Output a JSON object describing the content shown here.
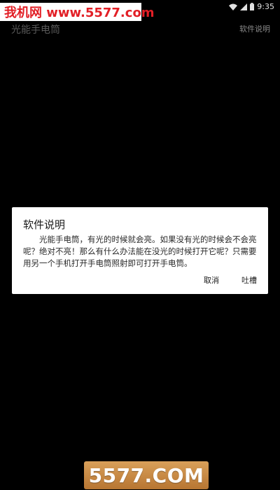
{
  "status_bar": {
    "time": "9:35",
    "icons": [
      "wifi-icon",
      "signal-icon",
      "battery-icon"
    ]
  },
  "watermark_top": {
    "text": "我机网 www.5577.com",
    "color": "#e21f26"
  },
  "app_bar": {
    "title": "光能手电筒",
    "action_label": "软件说明"
  },
  "dialog": {
    "title": "软件说明",
    "message": "光能手电筒，有光的时候就会亮。如果没有光的时候会不会亮呢？绝对不亮！那么有什么办法能在没光的时候打开它呢？只需要用另一个手机打开手电筒照射即可打开手电筒。",
    "cancel_label": "取消",
    "ok_label": "吐槽"
  },
  "watermark_bottom": {
    "text": "5577.COM",
    "color": "#c58a45"
  }
}
